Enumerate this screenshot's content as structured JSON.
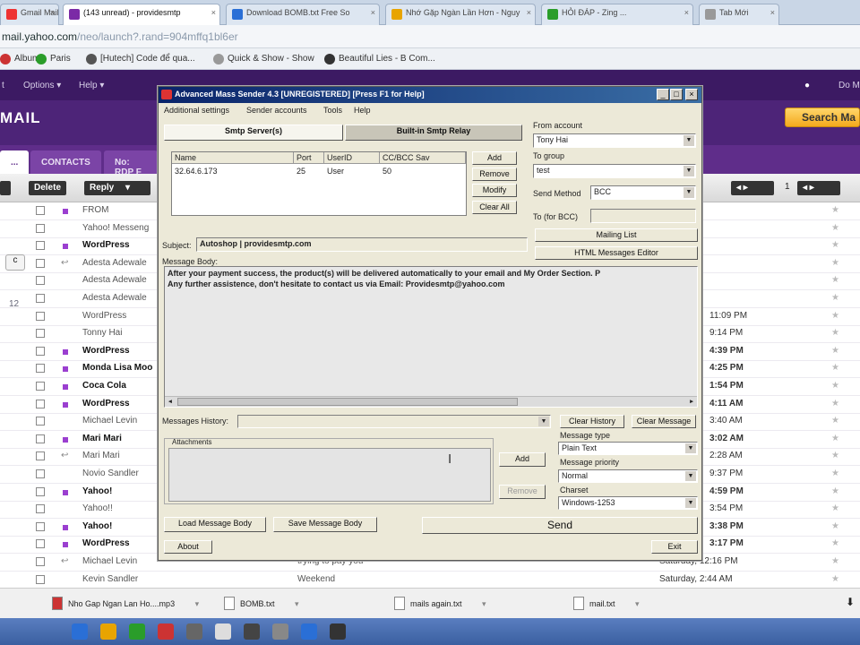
{
  "browser": {
    "tabs": [
      {
        "label": "Gmail Mail",
        "color": "#e33"
      },
      {
        "label": "(143 unread) - providesmtp",
        "color": "#7b2aa6",
        "active": true
      },
      {
        "label": "Download BOMB.txt Free So",
        "color": "#2a6fd6"
      },
      {
        "label": "Nhớ Gặp Ngàn Lần Hơn - Nguy",
        "color": "#e8a400"
      },
      {
        "label": "HỎI ĐÁP - Zing ...",
        "color": "#2a9d2a"
      },
      {
        "label": "Tab Mới",
        "color": "#999"
      }
    ],
    "url_main": "mail.yahoo.com",
    "url_rest": "/neo/launch?.rand=904mffq1bl6er",
    "bookmarks": [
      {
        "label": "Album",
        "color": "#c33"
      },
      {
        "label": "Paris",
        "color": "#2a9d2a"
      },
      {
        "label": "[Hutech] Code để qua...",
        "color": "#555"
      },
      {
        "label": "Quick & Show - Show",
        "color": "#999"
      },
      {
        "label": "Beautiful Lies - B Com...",
        "color": "#333"
      }
    ]
  },
  "yahoo": {
    "top_links": [
      "Options ▾",
      "Help ▾"
    ],
    "top_right": "Do M",
    "logo": "MAIL",
    "search_button": "Search Ma",
    "tabs": [
      "...",
      "CONTACTS",
      "No: RDP F"
    ],
    "toolbar": {
      "delete": "Delete",
      "reply": "Reply"
    },
    "rows": [
      {
        "from": "FROM",
        "bold": false,
        "date": "",
        "dot": true
      },
      {
        "from": "Yahoo! Messeng",
        "bold": false,
        "date": ""
      },
      {
        "from": "WordPress",
        "bold": true,
        "date": "",
        "dot": true
      },
      {
        "from": "Adesta Adewale",
        "bold": false,
        "date": "",
        "arr": true
      },
      {
        "from": "Adesta Adewale",
        "bold": false,
        "date": ""
      },
      {
        "from": "Adesta Adewale",
        "bold": false,
        "date": ""
      },
      {
        "from": "WordPress",
        "bold": false,
        "date": "11:09 PM"
      },
      {
        "from": "Tonny Hai",
        "bold": false,
        "date": "9:14 PM"
      },
      {
        "from": "WordPress",
        "bold": true,
        "date": "4:39 PM",
        "dot": true
      },
      {
        "from": "Monda Lisa Moo",
        "bold": true,
        "date": "4:25 PM",
        "dot": true
      },
      {
        "from": "Coca Cola",
        "bold": true,
        "date": "1:54 PM",
        "dot": true
      },
      {
        "from": "WordPress",
        "bold": true,
        "date": "4:11 AM",
        "dot": true
      },
      {
        "from": "Michael Levin",
        "bold": false,
        "date": "3:40 AM"
      },
      {
        "from": "Mari Mari",
        "bold": true,
        "date": "3:02 AM",
        "dot": true
      },
      {
        "from": "Mari Mari",
        "bold": false,
        "date": "2:28 AM",
        "arr": true
      },
      {
        "from": "Novio Sandler",
        "bold": false,
        "date": "9:37 PM"
      },
      {
        "from": "Yahoo!",
        "bold": true,
        "date": "4:59 PM",
        "dot": true
      },
      {
        "from": "Yahoo!!",
        "bold": false,
        "date": "3:54 PM"
      },
      {
        "from": "Yahoo!",
        "bold": true,
        "date": "3:38 PM",
        "dot": true
      },
      {
        "from": "WordPress",
        "bold": true,
        "date": "3:17 PM",
        "dot": true
      },
      {
        "from": "Michael Levin",
        "bold": false,
        "date": "Saturday, 12:16 PM",
        "arr": true,
        "subject": "trying to pay you"
      },
      {
        "from": "Kevin Sandler",
        "bold": false,
        "date": "Saturday, 2:44 AM",
        "subject": "Weekend"
      }
    ],
    "side_numbers": [
      "12"
    ]
  },
  "dialog": {
    "title": "Advanced Mass Sender 4.3    [UNREGISTERED]    [Press F1 for Help]",
    "menu": [
      "Additional settings",
      "Sender accounts",
      "Tools",
      "Help"
    ],
    "tab_smtp": "Smtp Server(s)",
    "tab_relay": "Built-in Smtp Relay",
    "grid_headers": [
      "Name",
      "Port",
      "UserID",
      "CC/BCC Sav"
    ],
    "grid_row": [
      "32.64.6.173",
      "25",
      "User",
      "50"
    ],
    "btn_add": "Add",
    "btn_remove": "Remove",
    "btn_modify": "Modify",
    "btn_clear_all": "Clear All",
    "from_account_label": "From account",
    "from_account_value": "Tony Hai",
    "to_group_label": "To group",
    "to_group_value": "test",
    "send_method_label": "Send Method",
    "send_method_value": "BCC",
    "to_bcc_label": "To (for BCC)",
    "mailing_list": "Mailing List",
    "html_editor": "HTML Messages Editor",
    "subject_label": "Subject:",
    "subject_value": "Autoshop | providesmtp.com",
    "body_label": "Message Body:",
    "body_line1": "After your payment success, the product(s) will be delivered automatically to your email and My Order Section. P",
    "body_line2": "Any further assistence, don't hesitate to contact us via Email: Providesmtp@yahoo.com",
    "history_label": "Messages History:",
    "clear_history": "Clear History",
    "clear_message": "Clear Message",
    "attachments_label": "Attachments",
    "attach_add": "Add",
    "attach_remove": "Remove",
    "msg_type_label": "Message type",
    "msg_type_value": "Plain Text",
    "msg_priority_label": "Message priority",
    "msg_priority_value": "Normal",
    "charset_label": "Charset",
    "charset_value": "Windows-1253",
    "load_body": "Load Message Body",
    "save_body": "Save Message Body",
    "send": "Send",
    "about": "About",
    "exit": "Exit"
  },
  "downloads": [
    {
      "label": "Nho Gap Ngan Lan Ho....mp3",
      "icon_color": "#c33"
    },
    {
      "label": "BOMB.txt",
      "icon_color": "#fff"
    },
    {
      "label": "mails again.txt",
      "icon_color": "#fff"
    },
    {
      "label": "mail.txt",
      "icon_color": "#fff"
    }
  ],
  "taskbar_icons": [
    "#2a6fd6",
    "#e8a400",
    "#2a9d2a",
    "#c33",
    "#666",
    "#ddd",
    "#444",
    "#888",
    "#2a6fd6",
    "#333"
  ]
}
